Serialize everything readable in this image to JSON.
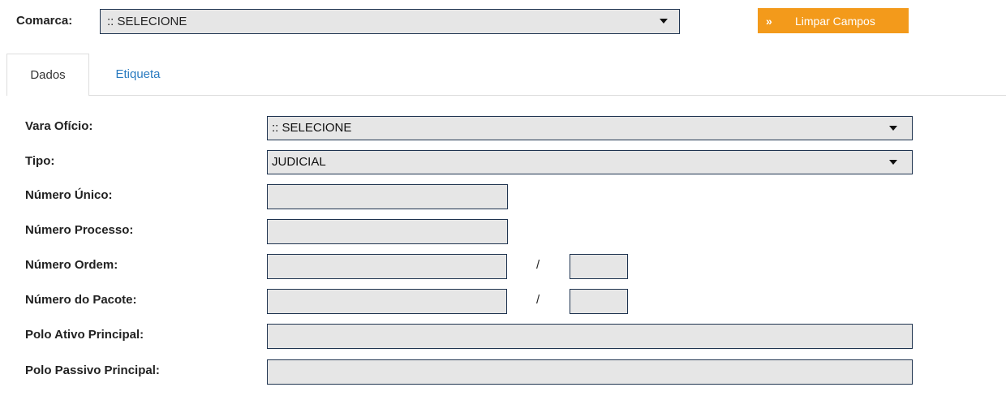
{
  "top": {
    "comarca_label": "Comarca:",
    "comarca_value": ":: SELECIONE",
    "limpar_icon": "double-chevron-right-icon",
    "limpar_label": "Limpar Campos"
  },
  "tabs": [
    {
      "label": "Dados",
      "active": true
    },
    {
      "label": "Etiqueta",
      "active": false
    }
  ],
  "form": {
    "vara_oficio_label": "Vara Ofício:",
    "vara_oficio_value": ":: SELECIONE",
    "tipo_label": "Tipo:",
    "tipo_value": "JUDICIAL",
    "numero_unico_label": "Número Único:",
    "numero_unico_value": "",
    "numero_processo_label": "Número Processo:",
    "numero_processo_value": "",
    "numero_ordem_label": "Número Ordem:",
    "numero_ordem_value": "",
    "numero_ordem_suffix_value": "",
    "numero_pacote_label": "Número do Pacote:",
    "numero_pacote_value": "",
    "numero_pacote_suffix_value": "",
    "separator": "/",
    "polo_ativo_label": "Polo Ativo Principal:",
    "polo_ativo_value": "",
    "polo_passivo_label": "Polo Passivo Principal:",
    "polo_passivo_value": ""
  },
  "colors": {
    "accent_button": "#f39a1b",
    "link_tab": "#2a7bc0",
    "field_bg": "#e6e6e6",
    "field_border": "#1f3450"
  }
}
